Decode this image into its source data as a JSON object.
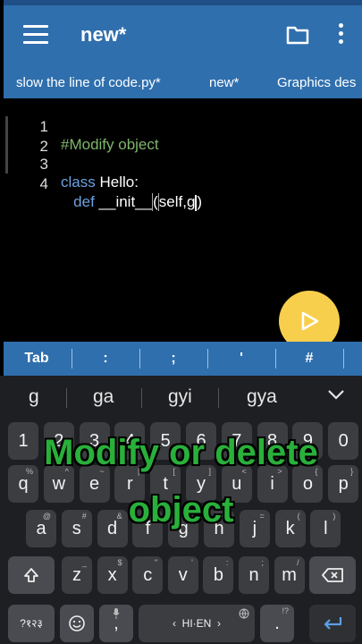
{
  "app": {
    "title": "new*"
  },
  "tabs": [
    "slow the line of code.py*",
    "new*",
    "Graphics des"
  ],
  "editor": {
    "line_numbers": [
      "1",
      "2",
      "3",
      "4"
    ],
    "line1_comment": "#Modify object",
    "line3_kw": "class",
    "line3_rest": " Hello:",
    "line4_indent": "   ",
    "line4_kw": "def",
    "line4_name": " __init__",
    "line4_paren": "(",
    "line4_args": "self,g",
    "line4_close": ")"
  },
  "symbol_bar": [
    "Tab",
    ":",
    ";",
    "'",
    "#"
  ],
  "keyboard": {
    "suggestions": [
      "g",
      "ga",
      "gyi",
      "gya"
    ],
    "row1": [
      "1",
      "2",
      "3",
      "4",
      "5",
      "6",
      "7",
      "8",
      "9",
      "0"
    ],
    "row2": [
      "q",
      "w",
      "e",
      "r",
      "t",
      "y",
      "u",
      "i",
      "o",
      "p"
    ],
    "row2_hints": [
      "%",
      "^",
      "~",
      "|",
      "[",
      "]",
      "<",
      ">",
      "{",
      "}"
    ],
    "row3": [
      "a",
      "s",
      "d",
      "f",
      "g",
      "h",
      "j",
      "k",
      "l"
    ],
    "row3_hints": [
      "@",
      "#",
      "&",
      "*",
      "-",
      "+",
      "=",
      "(",
      ")"
    ],
    "row4": [
      "z",
      "x",
      "c",
      "v",
      "b",
      "n",
      "m"
    ],
    "row4_hints": [
      "_",
      "$",
      "\"",
      "'",
      ":",
      ";",
      "/"
    ],
    "lang_key": "?१२३",
    "comma": ",",
    "space_label": "HI·EN",
    "period": ".",
    "period_hint": "!?"
  },
  "caption": {
    "line1": "Modify or delete",
    "line2": "object"
  },
  "colors": {
    "accent": "#2f6fad",
    "fab": "#f8cf4d",
    "caption": "#29b03a",
    "comment": "#7fb56a",
    "keyword": "#6da0e0"
  },
  "icons": [
    "menu-icon",
    "folder-icon",
    "more-vert-icon",
    "play-icon",
    "chevron-down-icon",
    "shift-icon",
    "backspace-icon",
    "emoji-icon",
    "mic-icon",
    "globe-icon",
    "enter-icon"
  ]
}
